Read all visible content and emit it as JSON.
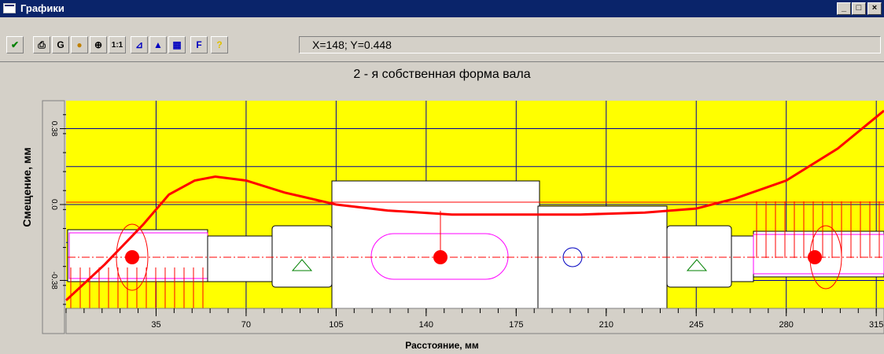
{
  "window": {
    "title": "Графики",
    "minimize_glyph": "_",
    "maximize_glyph": "□",
    "close_glyph": "×"
  },
  "toolbar": {
    "buttons": [
      {
        "icon": "checkmark-icon",
        "glyph": "✔",
        "color": "#008000"
      },
      {
        "icon": "print-icon",
        "glyph": "⎙",
        "color": "#000000"
      },
      {
        "icon": "grid-icon",
        "glyph": "G",
        "color": "#000000"
      },
      {
        "icon": "colors-icon",
        "glyph": "●",
        "color": "#c08000"
      },
      {
        "icon": "zoom-icon",
        "glyph": "⊕",
        "color": "#000000"
      },
      {
        "icon": "scale-1-1-icon",
        "glyph": "1:1",
        "color": "#000000"
      },
      {
        "icon": "axes-icon",
        "glyph": "⊿",
        "color": "#0000c0"
      },
      {
        "icon": "chart-icon",
        "glyph": "▲",
        "color": "#0000c0"
      },
      {
        "icon": "table-icon",
        "glyph": "▦",
        "color": "#0000c0"
      },
      {
        "icon": "font-icon",
        "glyph": "F",
        "color": "#0000c0"
      },
      {
        "icon": "help-icon",
        "glyph": "?",
        "color": "#e0c000"
      }
    ],
    "coord_readout": "X=148; Y=0.448"
  },
  "chart": {
    "title": "2 - я собственная форма вала",
    "ylabel": "Смещение, мм",
    "xlabel": "Расстояние, мм",
    "y_ticks": [
      "0.38",
      "0.0",
      "-0.38"
    ],
    "x_ticks": [
      "35",
      "70",
      "105",
      "140",
      "175",
      "210",
      "245",
      "280",
      "315"
    ],
    "colors": {
      "background": "#ffff00",
      "grid": "#0000a0",
      "curve": "#ff0000",
      "shaft": "#ffffff",
      "magenta": "#ff00ff"
    }
  },
  "chart_data": {
    "type": "line",
    "title": "2 - я собственная форма вала",
    "xlabel": "Расстояние, мм",
    "ylabel": "Смещение, мм",
    "xlim": [
      0,
      318
    ],
    "ylim": [
      -0.52,
      0.52
    ],
    "series": [
      {
        "x": [
          0,
          15,
          30,
          40,
          50,
          58,
          70,
          85,
          105,
          125,
          150,
          175,
          200,
          225,
          245,
          260,
          280,
          300,
          318
        ],
        "y": [
          -0.48,
          -0.3,
          -0.1,
          0.05,
          0.12,
          0.14,
          0.12,
          0.06,
          0.0,
          -0.03,
          -0.05,
          -0.05,
          -0.05,
          -0.04,
          -0.02,
          0.03,
          0.12,
          0.28,
          0.47
        ]
      }
    ]
  }
}
